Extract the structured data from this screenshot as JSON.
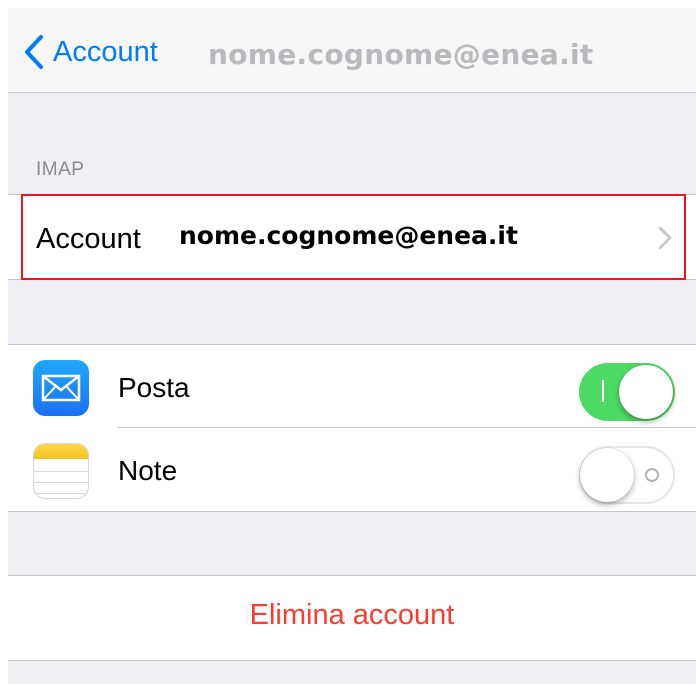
{
  "navbar": {
    "back_label": "Account",
    "email": "nome.cognome@enea.it"
  },
  "section_header": "IMAP",
  "account_row": {
    "label": "Account",
    "email": "nome.cognome@enea.it"
  },
  "toggles": [
    {
      "label": "Posta",
      "icon": "mail-icon",
      "state": "on"
    },
    {
      "label": "Note",
      "icon": "notes-icon",
      "state": "off"
    }
  ],
  "delete_button": {
    "label": "Elimina account",
    "color": "#ff3b30"
  },
  "colors": {
    "accent": "#007aff",
    "toggle_on": "#4cd964",
    "highlight": "#e8161c"
  }
}
